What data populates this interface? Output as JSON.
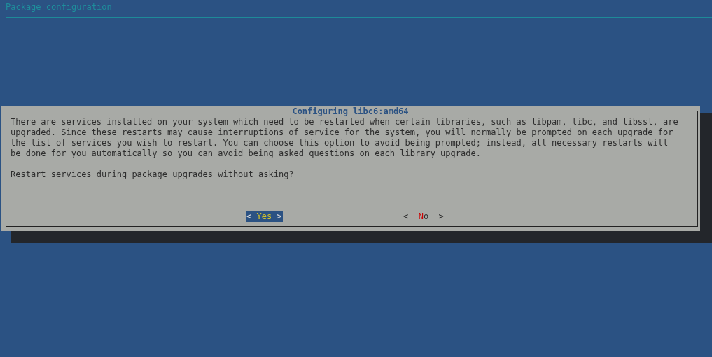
{
  "header": {
    "title": "Package configuration"
  },
  "dialog": {
    "title": "Configuring libc6:amd64",
    "message": "There are services installed on your system which need to be restarted when certain libraries, such as libpam, libc, and libssl, are upgraded. Since these restarts may cause interruptions of service for the system, you will normally be prompted on each upgrade for the list of services you wish to restart. You can choose this option to avoid being prompted; instead, all necessary restarts will be done for you automatically so you can avoid being asked questions on each library upgrade.",
    "question": "Restart services during package upgrades without asking?",
    "buttons": [
      {
        "open": "<",
        "label": "Yes",
        "close": ">",
        "selected": true
      },
      {
        "open": "<",
        "label": "No",
        "close": ">",
        "selected": false
      }
    ]
  }
}
